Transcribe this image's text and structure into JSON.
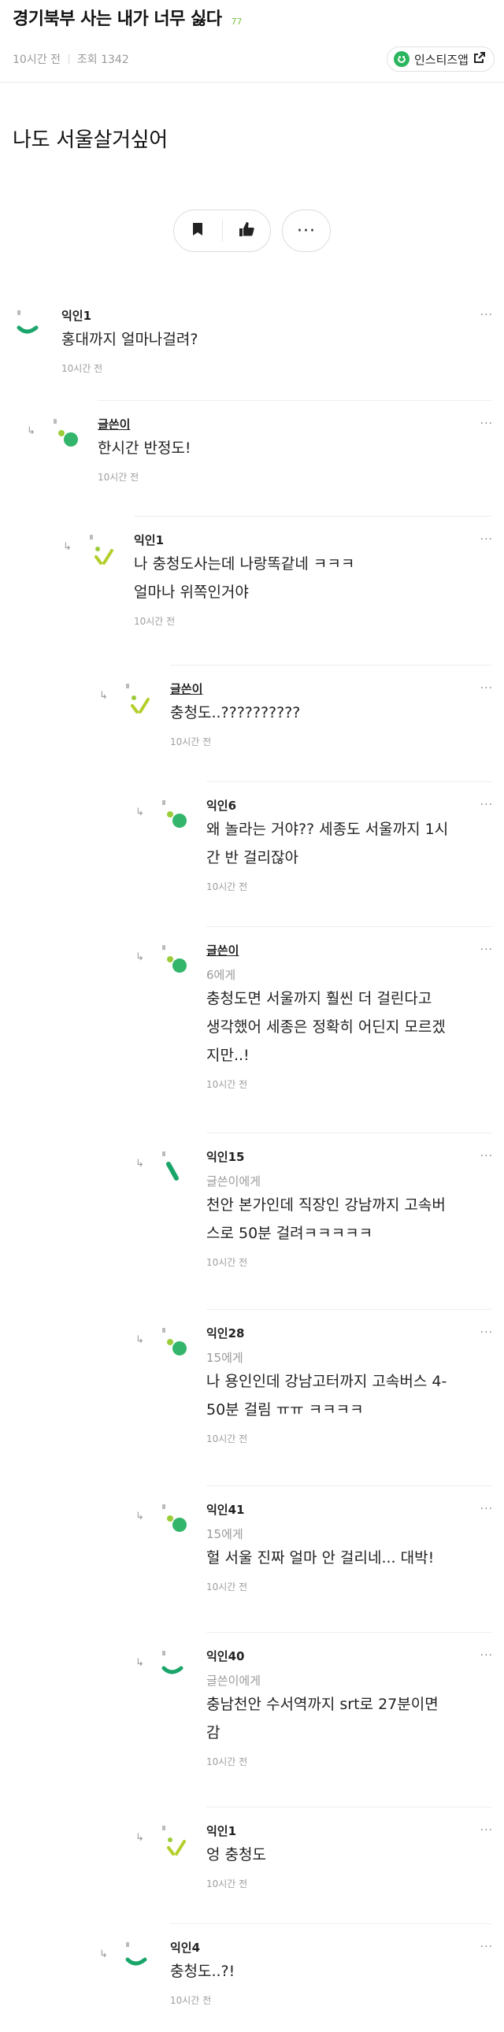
{
  "post": {
    "title": "경기북부 사는 내가 너무 싫다",
    "comment_count": "77",
    "time": "10시간 전",
    "views": "조회 1342",
    "app_button": "인스티즈앱",
    "body": "나도 서울살거싶어"
  },
  "actions": {
    "bookmark_icon": "bookmark-icon",
    "like_icon": "thumbs-up-icon",
    "more_label": "···"
  },
  "comments": [
    {
      "nick": "익인1",
      "target": "",
      "text": "홍대까지 얼마나걸려?",
      "time": "10시간 전",
      "author": false
    },
    {
      "nick": "글쓴이",
      "target": "",
      "text": "한시간 반정도!",
      "time": "10시간 전",
      "author": true
    },
    {
      "nick": "익인1",
      "target": "",
      "text": "나 충청도사는데 나랑똑같네 ㅋㅋㅋ\n얼마나 위쪽인거야",
      "time": "10시간 전",
      "author": false
    },
    {
      "nick": "글쓴이",
      "target": "",
      "text": "충청도..??????????",
      "time": "10시간 전",
      "author": true
    },
    {
      "nick": "익인6",
      "target": "",
      "text": "왜 놀라는 거야?? 세종도 서울까지 1시\n간 반 걸리잖아",
      "time": "10시간 전",
      "author": false
    },
    {
      "nick": "글쓴이",
      "target": "6에게",
      "text": "충청도면 서울까지 훨씬 더 걸린다고\n생각했어 세종은 정확히 어딘지 모르겠\n지만..!",
      "time": "10시간 전",
      "author": true
    },
    {
      "nick": "익인15",
      "target": "글쓴이에게",
      "text": "천안 본가인데 직장인 강남까지 고속버\n스로 50분 걸려ㅋㅋㅋㅋㅋ",
      "time": "10시간 전",
      "author": false
    },
    {
      "nick": "익인28",
      "target": "15에게",
      "text": "나 용인인데 강남고터까지 고속버스 4-\n50분 걸림 ㅠㅠ ㅋㅋㅋㅋ",
      "time": "10시간 전",
      "author": false
    },
    {
      "nick": "익인41",
      "target": "15에게",
      "text": "헐 서울 진짜 얼마 안 걸리네... 대박!",
      "time": "10시간 전",
      "author": false
    },
    {
      "nick": "익인40",
      "target": "글쓴이에게",
      "text": "충남천안 수서역까지 srt로 27분이면\n감",
      "time": "10시간 전",
      "author": false
    },
    {
      "nick": "익인1",
      "target": "",
      "text": "엉 충청도",
      "time": "10시간 전",
      "author": false
    },
    {
      "nick": "익인4",
      "target": "",
      "text": "충청도..?!",
      "time": "10시간 전",
      "author": false
    }
  ]
}
